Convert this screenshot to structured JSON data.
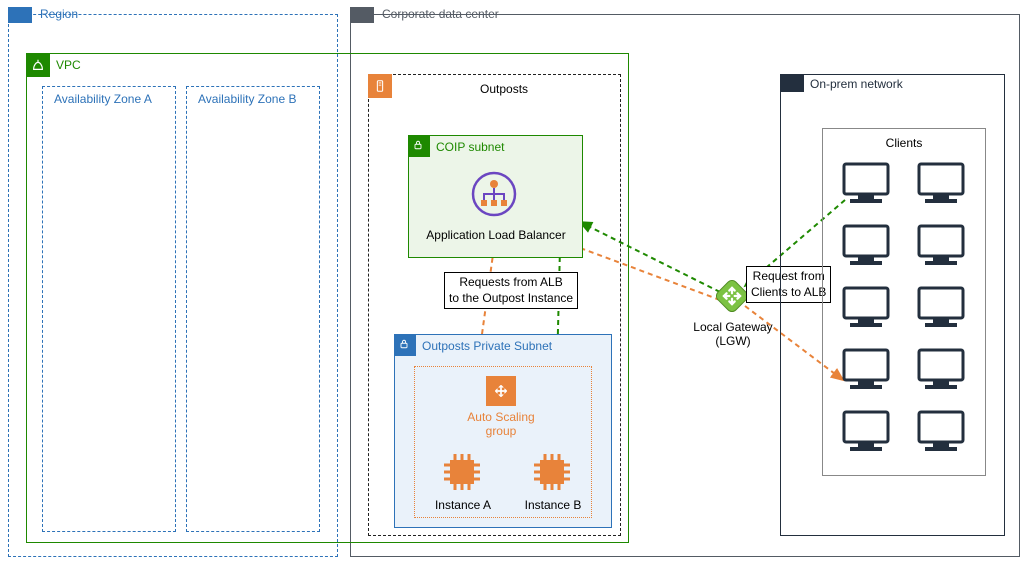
{
  "region": {
    "label": "Region"
  },
  "vpc": {
    "label": "VPC"
  },
  "az_a": {
    "label": "Availability Zone A"
  },
  "az_b": {
    "label": "Availability Zone B"
  },
  "corp_dc": {
    "label": "Corporate data center"
  },
  "outposts": {
    "label": "Outposts"
  },
  "coip_subnet": {
    "label": "COIP subnet"
  },
  "alb": {
    "label": "Application Load Balancer"
  },
  "priv_subnet": {
    "label": "Outposts Private Subnet"
  },
  "asg": {
    "label": "Auto Scaling\ngroup"
  },
  "instance_a": {
    "label": "Instance A"
  },
  "instance_b": {
    "label": "Instance B"
  },
  "anno_alb": {
    "text": "Requests from ALB\nto the Outpost Instance"
  },
  "anno_clients": {
    "text": "Request from\nClients to ALB"
  },
  "lgw": {
    "label": "Local Gateway\n(LGW)"
  },
  "onprem": {
    "label": "On-prem network"
  },
  "clients": {
    "label": "Clients"
  },
  "colors": {
    "blue": "#2D72B8",
    "green": "#1E8900",
    "orange": "#E8833A",
    "navy": "#232F3E",
    "lgw_green": "#7CC243",
    "purple": "#6B46C1"
  }
}
